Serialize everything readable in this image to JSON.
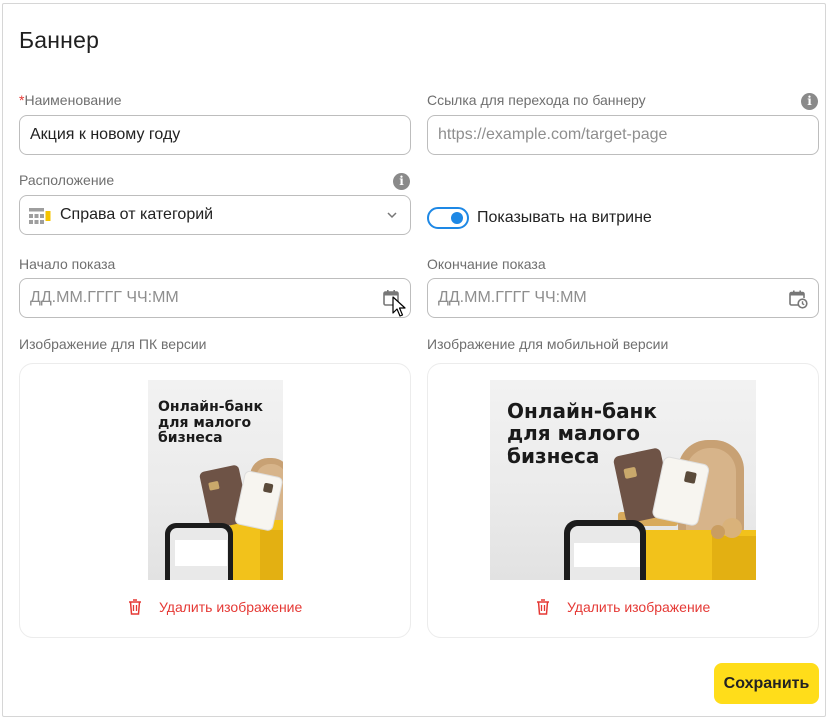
{
  "form": {
    "title": "Баннер",
    "name": {
      "required_mark": "*",
      "label": "Наименование",
      "value": "Акция к новому году"
    },
    "link": {
      "label": "Ссылка для перехода по баннеру",
      "placeholder": "https://example.com/target-page"
    },
    "placement": {
      "label": "Расположение",
      "value": "Справа от категорий"
    },
    "showcase_toggle": {
      "label": "Показывать на витрине",
      "on": true
    },
    "start": {
      "label": "Начало показа",
      "placeholder": "ДД.ММ.ГГГГ ЧЧ:ММ"
    },
    "end": {
      "label": "Окончание показа",
      "placeholder": "ДД.ММ.ГГГГ ЧЧ:ММ"
    },
    "pc_image": {
      "label": "Изображение для ПК версии",
      "banner_text": "Онлайн-банк для малого бизнеса",
      "delete_label": "Удалить изображение"
    },
    "mobile_image": {
      "label": "Изображение для мобильной версии",
      "banner_text": "Онлайн-банк для малого бизнеса",
      "delete_label": "Удалить изображение"
    },
    "save_label": "Сохранить",
    "info_glyph": "i"
  },
  "colors": {
    "accent_yellow": "#ffdd1a",
    "toggle_blue": "#1e88e5",
    "danger_red": "#e53935",
    "placement_icon_yellow": "#f5c400"
  },
  "icons": [
    "info-icon",
    "layout-grid-icon",
    "chevron-down-icon",
    "calendar-icon",
    "calendar-clock-icon",
    "trash-icon",
    "pointer-cursor-icon"
  ]
}
